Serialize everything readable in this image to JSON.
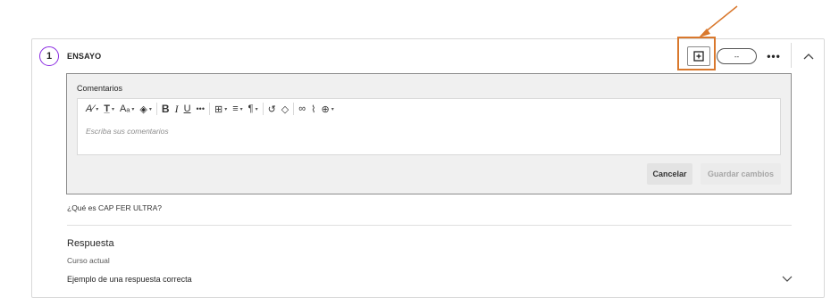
{
  "question": {
    "number": "1",
    "type_label": "ENSAYO",
    "points_value": "--",
    "more_label": "•••",
    "text": "¿Qué es CAP FER ULTRA?"
  },
  "editor": {
    "label": "Comentarios",
    "placeholder": "Escriba sus comentarios",
    "cancel_label": "Cancelar",
    "save_label": "Guardar cambios",
    "toolbar": [
      {
        "name": "text-style",
        "glyph": "A⁄",
        "caret": true
      },
      {
        "name": "paragraph-format",
        "glyph": "T̲",
        "caret": true
      },
      {
        "name": "font-size",
        "glyph": "Aₐ",
        "caret": true
      },
      {
        "name": "text-color",
        "glyph": "◈",
        "caret": true
      },
      {
        "name": "bold",
        "glyph": "B",
        "caret": false
      },
      {
        "name": "italic",
        "glyph": "I",
        "caret": false
      },
      {
        "name": "underline",
        "glyph": "U",
        "caret": false
      },
      {
        "name": "more",
        "glyph": "•••",
        "caret": false
      },
      {
        "name": "table",
        "glyph": "⊞",
        "caret": true
      },
      {
        "name": "align",
        "glyph": "≡",
        "caret": true
      },
      {
        "name": "paragraph",
        "glyph": "¶",
        "caret": true
      },
      {
        "name": "undo",
        "glyph": "↺",
        "caret": false
      },
      {
        "name": "clear-format",
        "glyph": "◇",
        "caret": false
      },
      {
        "name": "link",
        "glyph": "∞",
        "caret": false
      },
      {
        "name": "attach",
        "glyph": "⌇",
        "caret": false
      },
      {
        "name": "insert",
        "glyph": "⊕",
        "caret": true
      }
    ]
  },
  "answer": {
    "title": "Respuesta",
    "subtitle": "Curso actual",
    "example_label": "Ejemplo de una respuesta correcta"
  },
  "colors": {
    "accent": "#8a2be2",
    "highlight": "#d9782d"
  },
  "icons": {
    "feedback": "add-feedback-icon",
    "collapse": "chevron-up-icon",
    "expand": "chevron-down-icon"
  }
}
